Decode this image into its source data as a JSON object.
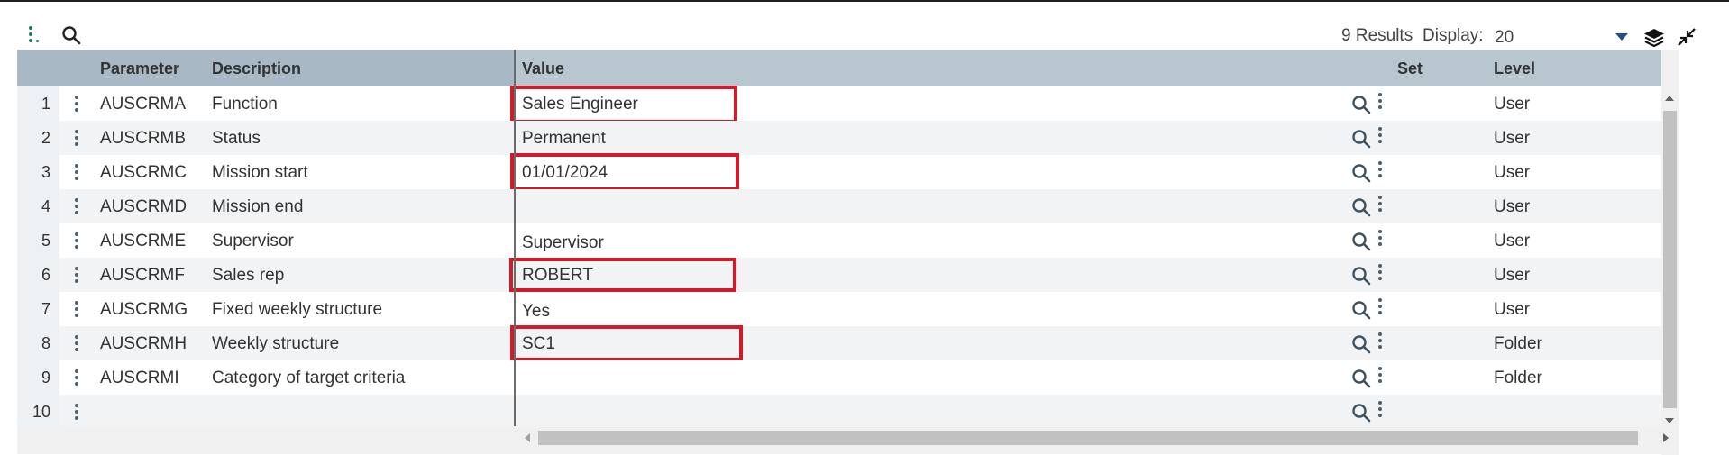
{
  "toolbar": {
    "results_text": "9 Results",
    "display_label": "Display:",
    "display_value": "20"
  },
  "columns": {
    "parameter": "Parameter",
    "description": "Description",
    "value": "Value",
    "set": "Set",
    "level": "Level"
  },
  "rows": [
    {
      "num": "1",
      "parameter": "AUSCRMA",
      "description": "Function",
      "value": "Sales Engineer",
      "level": "User",
      "highlighted": true
    },
    {
      "num": "2",
      "parameter": "AUSCRMB",
      "description": "Status",
      "value": "Permanent",
      "level": "User",
      "highlighted": false
    },
    {
      "num": "3",
      "parameter": "AUSCRMC",
      "description": "Mission start",
      "value": "01/01/2024",
      "level": "User",
      "highlighted": true
    },
    {
      "num": "4",
      "parameter": "AUSCRMD",
      "description": "Mission end",
      "value": "",
      "level": "User",
      "highlighted": false
    },
    {
      "num": "5",
      "parameter": "AUSCRME",
      "description": "Supervisor",
      "value": "Supervisor",
      "level": "User",
      "highlighted": false
    },
    {
      "num": "6",
      "parameter": "AUSCRMF",
      "description": "Sales rep",
      "value": "ROBERT",
      "level": "User",
      "highlighted": true
    },
    {
      "num": "7",
      "parameter": "AUSCRMG",
      "description": "Fixed weekly structure",
      "value": "Yes",
      "level": "User",
      "highlighted": false
    },
    {
      "num": "8",
      "parameter": "AUSCRMH",
      "description": "Weekly structure",
      "value": "SC1",
      "level": "Folder",
      "highlighted": true
    },
    {
      "num": "9",
      "parameter": "AUSCRMI",
      "description": "Category of target criteria",
      "value": "",
      "level": "Folder",
      "highlighted": false
    },
    {
      "num": "10",
      "parameter": "",
      "description": "",
      "value": "",
      "level": "",
      "highlighted": false
    }
  ],
  "colors": {
    "highlight": "#d11a2a",
    "accent": "#1e7a62",
    "header_bg": "#b8c6d0"
  },
  "icons": {
    "menu": "vertical-dots-icon",
    "search": "search-icon",
    "layers": "layers-icon",
    "collapse": "collapse-icon",
    "row_lookup": "search-icon",
    "row_menu": "kebab-icon"
  }
}
